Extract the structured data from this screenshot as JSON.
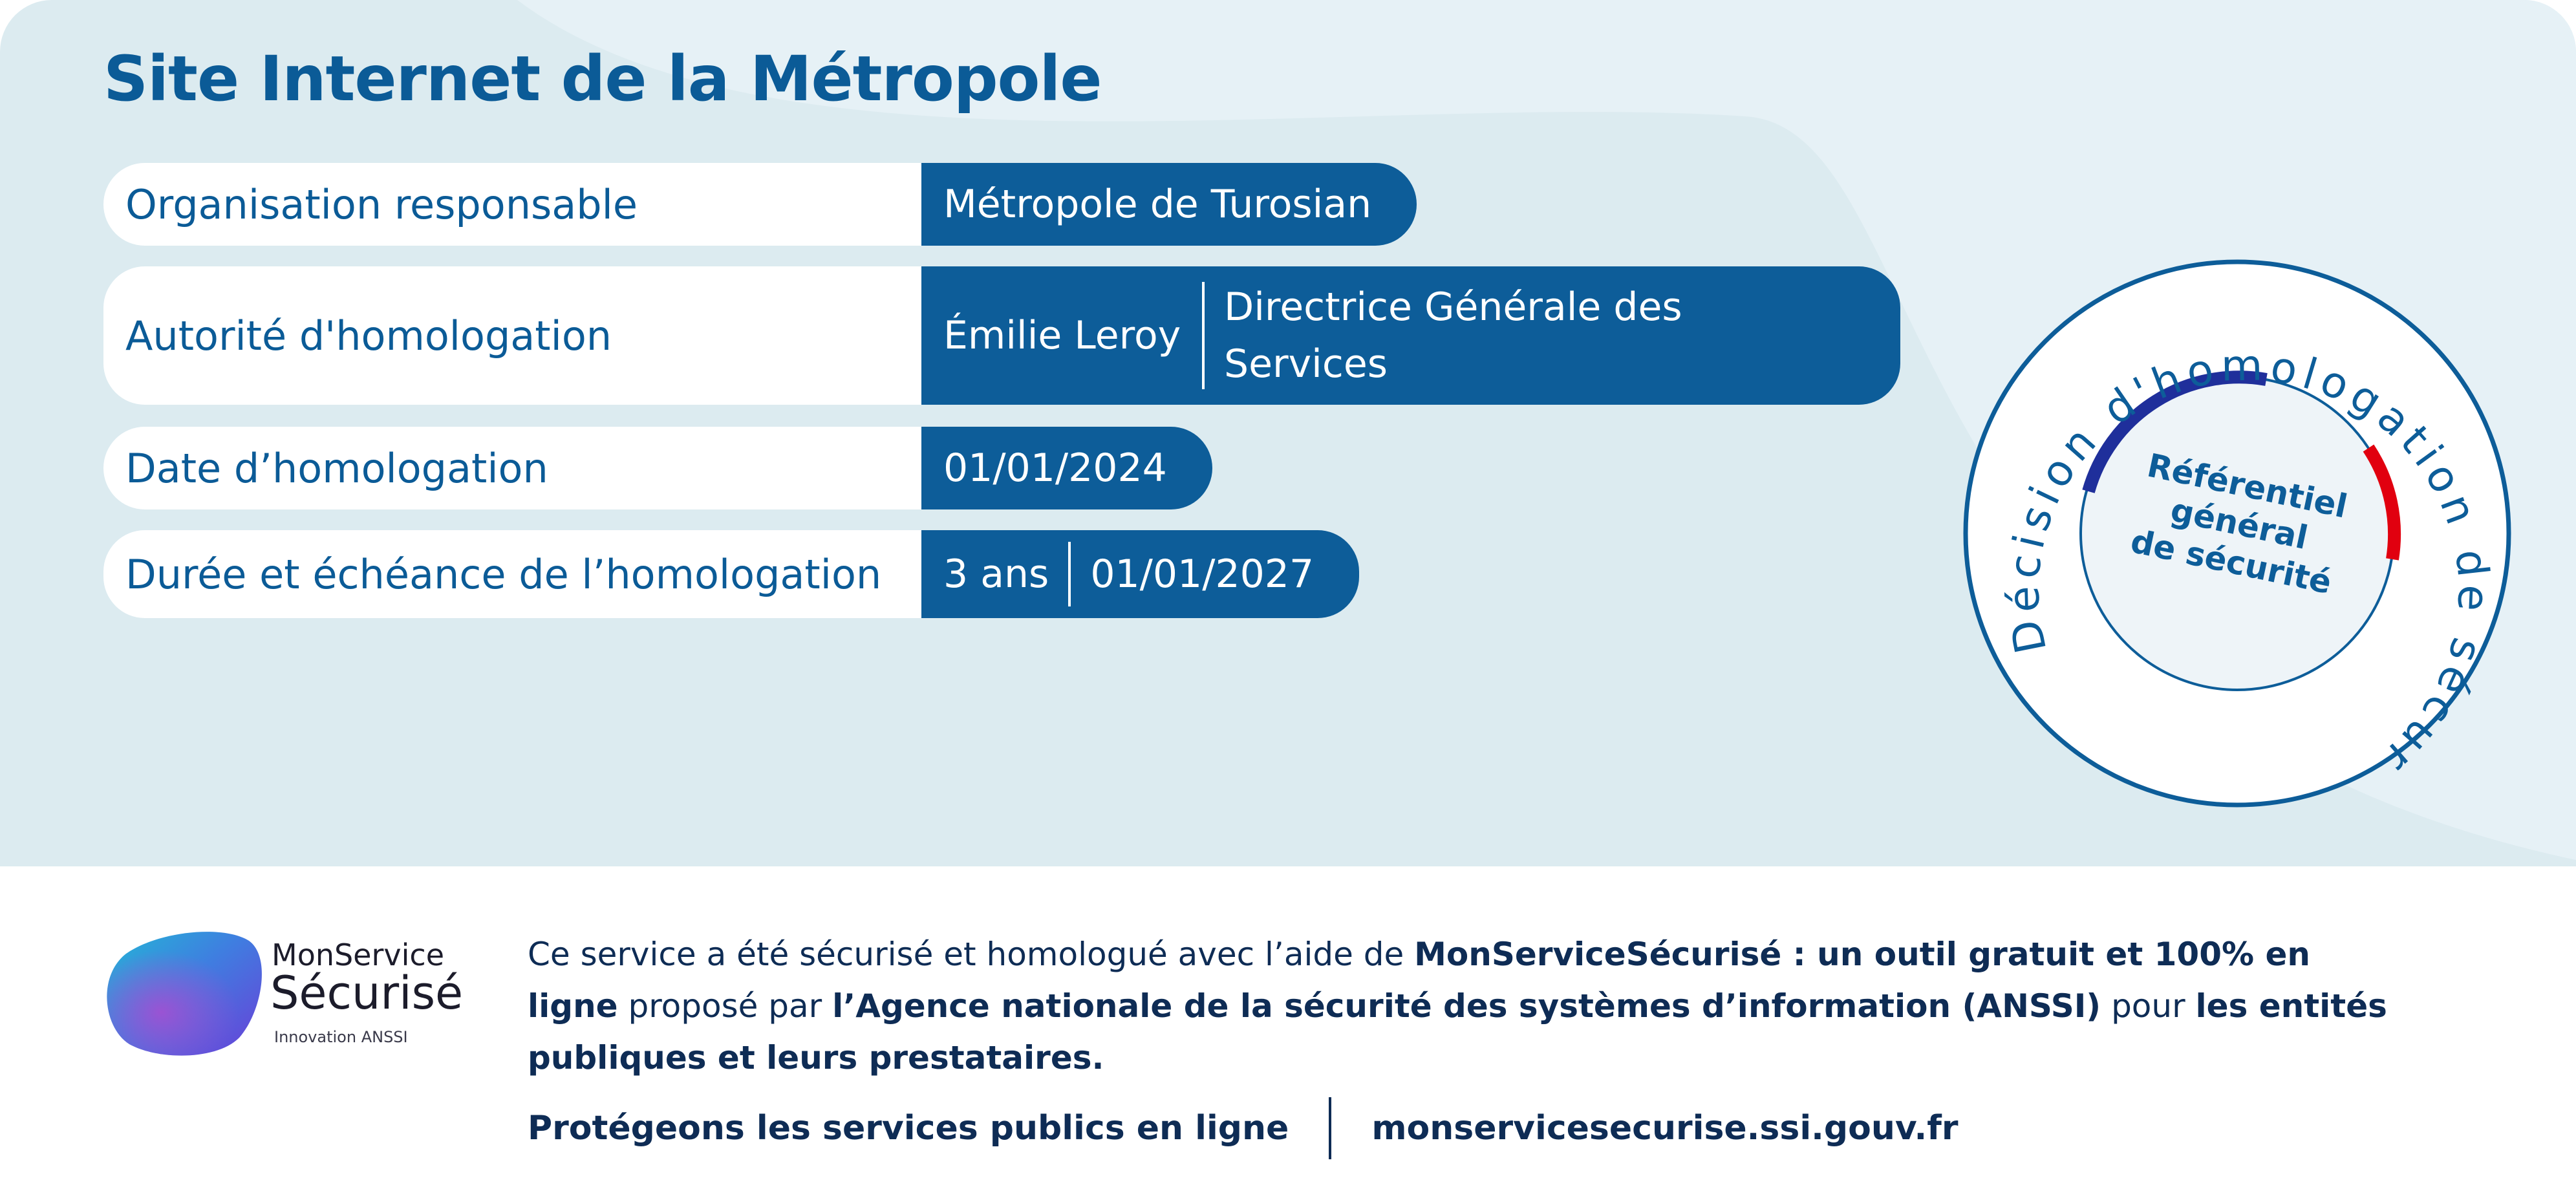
{
  "title": "Site Internet de la Métropole",
  "rows": {
    "organisation": {
      "label": "Organisation responsable",
      "value": "Métropole de Turosian"
    },
    "autorite": {
      "label": "Autorité d'homologation",
      "name": "Émilie Leroy",
      "role": "Directrice Générale des Services"
    },
    "date": {
      "label": "Date d’homologation",
      "value": "01/01/2024"
    },
    "duree": {
      "label": "Durée et échéance de l’homologation",
      "duration": "3 ans",
      "expiry": "01/01/2027"
    }
  },
  "seal": {
    "ring_text": "Décision d'homologation de sécurité",
    "inner_line1": "Référentiel",
    "inner_line2": "général",
    "inner_line3": "de sécurité"
  },
  "footer": {
    "brand_line1": "MonService",
    "brand_line2": "Sécurisé",
    "brand_line3": "Innovation ANSSI",
    "desc_part1": "Ce service a été sécurisé et homologué avec l’aide de ",
    "desc_bold1": "MonServiceSécurisé : un outil gratuit et 100% en ligne",
    "desc_part2": " proposé par ",
    "desc_bold2": "l’Agence nationale de la sécurité des systèmes d’information (ANSSI)",
    "desc_part3": " pour ",
    "desc_bold3": "les entités publiques et leurs prestataires.",
    "tagline": "Protégeons les services publics en ligne",
    "url": "monservicesecurise.ssi.gouv.fr"
  },
  "colors": {
    "primary_blue": "#0d5d99",
    "light_bg": "#dcebf0",
    "text_dark": "#0e2c55",
    "flag_blue": "#1f2f9b",
    "flag_red": "#e1000f"
  },
  "icons": {
    "logo": "monservice-securise-logo-blob"
  }
}
